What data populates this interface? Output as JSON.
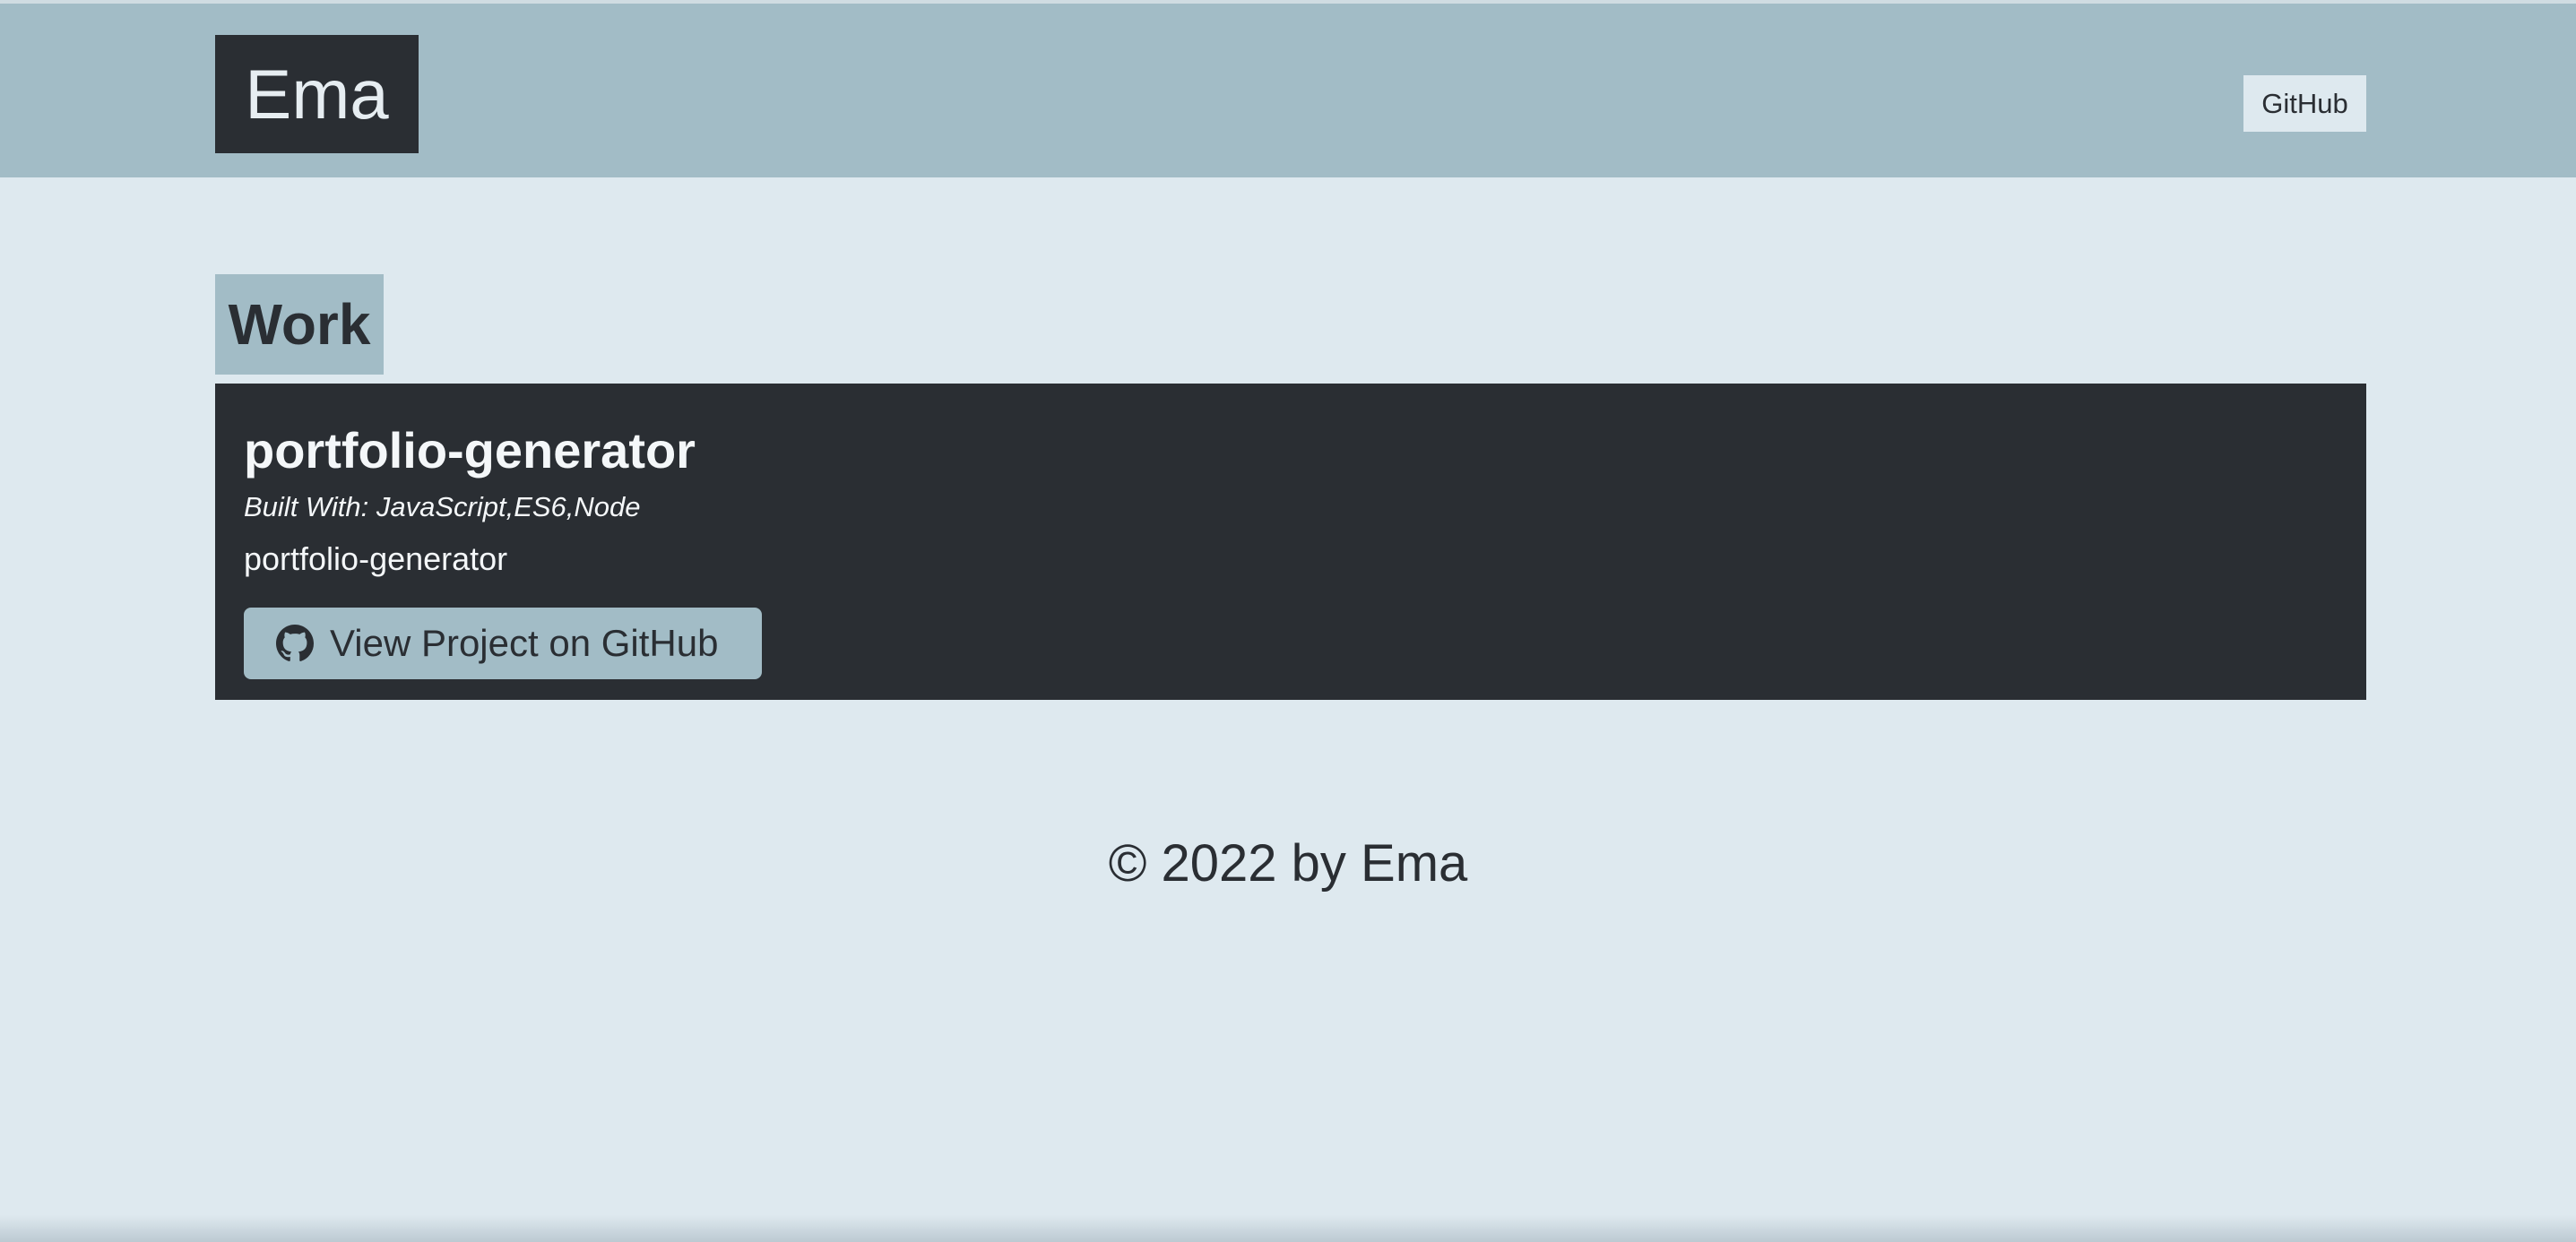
{
  "header": {
    "logo_text": "Ema",
    "nav_link_label": "GitHub"
  },
  "work": {
    "section_title": "Work",
    "projects": [
      {
        "name": "portfolio-generator",
        "built_with": "Built With: JavaScript,ES6,Node",
        "description": "portfolio-generator",
        "button_label": "View Project on GitHub",
        "button_icon": "github-icon"
      }
    ]
  },
  "footer": {
    "text": "© 2022 by Ema"
  },
  "colors": {
    "header_bg": "#a2bcc6",
    "page_bg": "#dee9ef",
    "dark": "#2a2e33",
    "accent": "#a2bcc6"
  }
}
